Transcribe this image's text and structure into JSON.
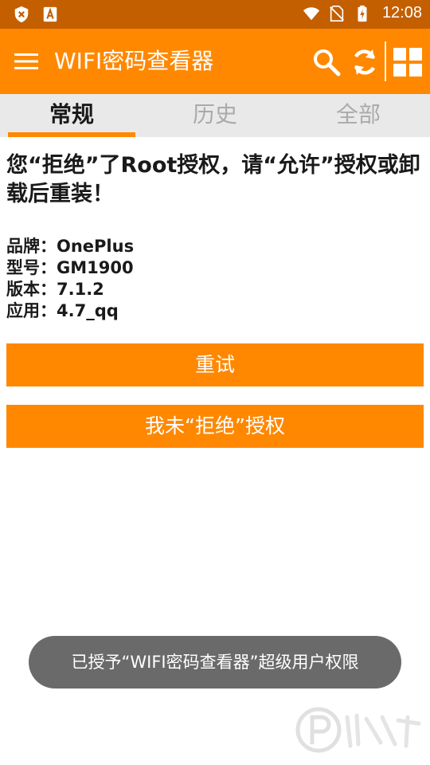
{
  "status_bar": {
    "time": "12:08",
    "icons_left": [
      "close-shield-icon",
      "font-a-icon"
    ],
    "icons_right": [
      "wifi-icon",
      "no-sim-icon",
      "battery-charging-icon"
    ]
  },
  "app_bar": {
    "title": "WIFI密码查看器",
    "icons": [
      "menu-icon",
      "search-icon",
      "refresh-icon",
      "grid-icon"
    ]
  },
  "tabs": [
    {
      "label": "常规",
      "active": true
    },
    {
      "label": "历史",
      "active": false
    },
    {
      "label": "全部",
      "active": false
    }
  ],
  "main": {
    "message": "您“拒绝”了Root授权，请“允许”授权或卸载后重装！",
    "info": [
      {
        "key": "品牌：",
        "value": "OnePlus"
      },
      {
        "key": "型号：",
        "value": "GM1900"
      },
      {
        "key": "版本：",
        "value": "7.1.2"
      },
      {
        "key": "应用：",
        "value": "4.7_qq"
      }
    ],
    "retry_label": "重试",
    "not_denied_label": "我未“拒绝”授权"
  },
  "toast": {
    "text": "已授予“WIFI密码查看器”超级用户权限"
  },
  "colors": {
    "status_bar": "#c45f00",
    "accent": "#ff8800",
    "tab_strip": "#e9e9e9",
    "toast": "#6a6a6a"
  }
}
